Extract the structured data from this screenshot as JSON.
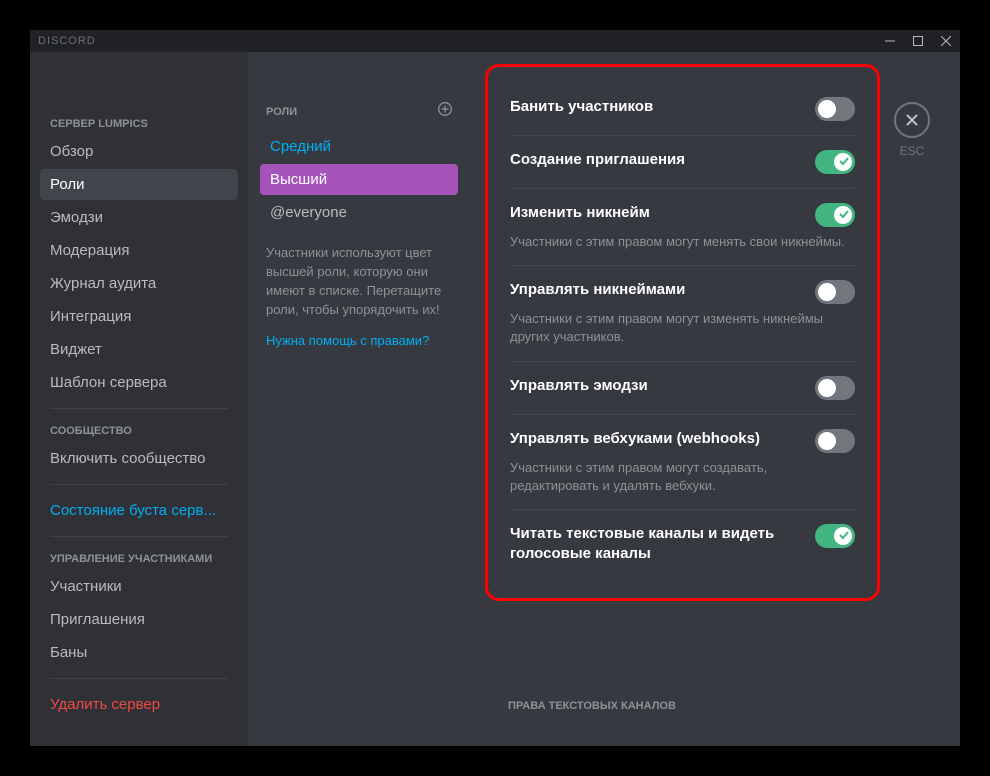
{
  "titlebar": {
    "app_name": "DISCORD"
  },
  "close": {
    "esc_label": "ESC"
  },
  "sidebar": {
    "server_header": "СЕРВЕР LUMPICS",
    "items_main": [
      {
        "label": "Обзор",
        "selected": false
      },
      {
        "label": "Роли",
        "selected": true
      },
      {
        "label": "Эмодзи",
        "selected": false
      },
      {
        "label": "Модерация",
        "selected": false
      },
      {
        "label": "Журнал аудита",
        "selected": false
      },
      {
        "label": "Интеграция",
        "selected": false
      },
      {
        "label": "Виджет",
        "selected": false
      },
      {
        "label": "Шаблон сервера",
        "selected": false
      }
    ],
    "community_header": "СООБЩЕСТВО",
    "community_item": "Включить сообщество",
    "boost_link": "Состояние буста серв...",
    "members_header": "УПРАВЛЕНИЕ УЧАСТНИКАМИ",
    "members_items": [
      {
        "label": "Участники"
      },
      {
        "label": "Приглашения"
      },
      {
        "label": "Баны"
      }
    ],
    "delete_server": "Удалить сервер"
  },
  "roles": {
    "header": "РОЛИ",
    "list": [
      {
        "label": "Средний",
        "style": "blue"
      },
      {
        "label": "Высший",
        "style": "purple-selected"
      },
      {
        "label": "@everyone",
        "style": "everyone"
      }
    ],
    "help_text": "Участники используют цвет высшей роли, которую они имеют в списке. Перетащите роли, чтобы упорядочить их!",
    "help_link": "Нужна помощь с правами?"
  },
  "permissions": {
    "items": [
      {
        "title": "Банить участников",
        "desc": "",
        "on": false
      },
      {
        "title": "Создание приглашения",
        "desc": "",
        "on": true
      },
      {
        "title": "Изменить никнейм",
        "desc": "Участники с этим правом могут менять свои никнеймы.",
        "on": true
      },
      {
        "title": "Управлять никнеймами",
        "desc": "Участники с этим правом могут изменять никнеймы других участников.",
        "on": false
      },
      {
        "title": "Управлять эмодзи",
        "desc": "",
        "on": false
      },
      {
        "title": "Управлять вебхуками (webhooks)",
        "desc": "Участники с этим правом могут создавать, редактировать и удалять вебхуки.",
        "on": false
      },
      {
        "title": "Читать текстовые каналы и видеть голосовые каналы",
        "desc": "",
        "on": true
      }
    ],
    "text_channels_header": "ПРАВА ТЕКСТОВЫХ КАНАЛОВ"
  }
}
